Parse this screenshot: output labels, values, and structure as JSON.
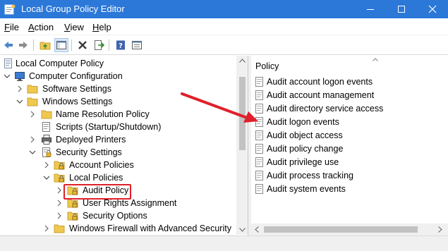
{
  "window": {
    "title": "Local Group Policy Editor"
  },
  "menu": [
    {
      "label": "File",
      "mnemonic": "F",
      "rest": "ile"
    },
    {
      "label": "Action",
      "mnemonic": "A",
      "rest": "ction"
    },
    {
      "label": "View",
      "mnemonic": "V",
      "rest": "iew"
    },
    {
      "label": "Help",
      "mnemonic": "H",
      "rest": "elp"
    }
  ],
  "tree": {
    "items": [
      {
        "label": "Local Computer Policy"
      },
      {
        "label": "Computer Configuration"
      },
      {
        "label": "Software Settings"
      },
      {
        "label": "Windows Settings"
      },
      {
        "label": "Name Resolution Policy"
      },
      {
        "label": "Scripts (Startup/Shutdown)"
      },
      {
        "label": "Deployed Printers"
      },
      {
        "label": "Security Settings"
      },
      {
        "label": "Account Policies"
      },
      {
        "label": "Local Policies"
      },
      {
        "label": "Audit Policy"
      },
      {
        "label": "User Rights Assignment"
      },
      {
        "label": "Security Options"
      },
      {
        "label": "Windows Firewall with Advanced Security"
      }
    ]
  },
  "list": {
    "header": "Policy",
    "items": [
      "Audit account logon events",
      "Audit account management",
      "Audit directory service access",
      "Audit logon events",
      "Audit object access",
      "Audit policy change",
      "Audit privilege use",
      "Audit process tracking",
      "Audit system events"
    ]
  },
  "colors": {
    "titlebar": "#2b78d8",
    "annotation": "#e0202a",
    "folder": "#f0c850"
  },
  "icons": {
    "app": "gpedit-icon",
    "back": "back-arrow-icon",
    "forward": "forward-arrow-icon",
    "up": "up-folder-icon",
    "show-hide": "show-hide-tree-icon",
    "delete": "delete-icon",
    "export": "export-list-icon",
    "help": "help-icon",
    "properties": "properties-icon"
  }
}
